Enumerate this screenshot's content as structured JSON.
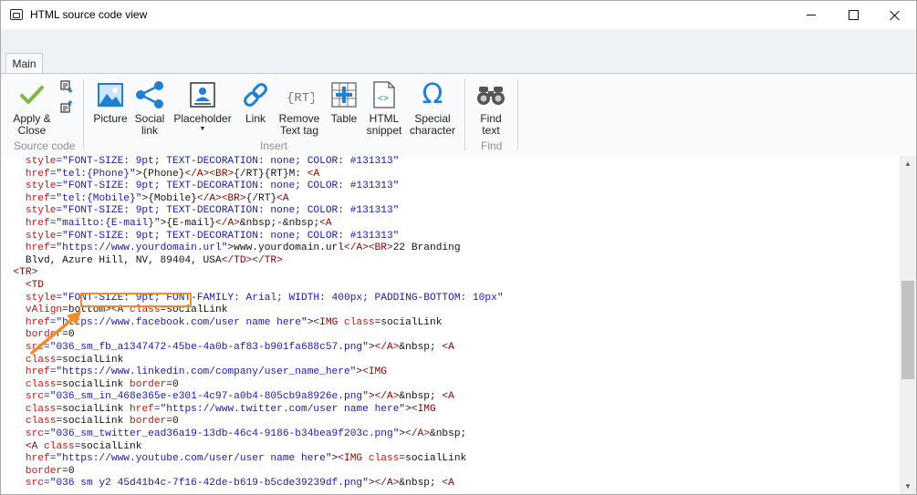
{
  "window": {
    "title": "HTML source code view"
  },
  "ribbon": {
    "tab_main": "Main",
    "groups": {
      "source_code": "Source code",
      "insert": "Insert",
      "find": "Find"
    },
    "buttons": {
      "apply_close_line1": "Apply &",
      "apply_close_line2": "Close",
      "picture": "Picture",
      "social_link_line1": "Social",
      "social_link_line2": "link",
      "placeholder": "Placeholder",
      "link": "Link",
      "remove_text_tag_line1": "Remove",
      "remove_text_tag_line2": "Text tag",
      "table": "Table",
      "html_snippet_line1": "HTML",
      "html_snippet_line2": "snippet",
      "special_char_line1": "Special",
      "special_char_line2": "character",
      "find_text_line1": "Find",
      "find_text_line2": "text"
    }
  },
  "colors": {
    "accent_orange": "#f28c28",
    "attr_red": "#c81414",
    "value_blue": "#1a1aa6",
    "check_green": "#7fba3a",
    "icon_blue": "#1f7fd0"
  },
  "code_lines": [
    [
      [
        "    ",
        "b"
      ],
      [
        "style",
        "r"
      ],
      [
        "=\"FONT-SIZE: 9pt; TEXT-DECORATION: none; COLOR: #131313\"",
        "u"
      ]
    ],
    [
      [
        "    ",
        "b"
      ],
      [
        "href",
        "r"
      ],
      [
        "=\"tel:",
        "u"
      ],
      [
        "{Phone}",
        "u"
      ],
      [
        "\"",
        "u"
      ],
      [
        ">{Phone}",
        "k"
      ],
      [
        "</A>",
        "t"
      ],
      [
        "<BR>",
        "t"
      ],
      [
        "{/RT}{RT}M: ",
        "k"
      ],
      [
        "<A",
        "t"
      ]
    ],
    [
      [
        "    ",
        "b"
      ],
      [
        "style",
        "r"
      ],
      [
        "=\"FONT-SIZE: 9pt; TEXT-DECORATION: none; COLOR: #131313\"",
        "u"
      ]
    ],
    [
      [
        "    ",
        "b"
      ],
      [
        "href",
        "r"
      ],
      [
        "=\"tel:",
        "u"
      ],
      [
        "{Mobile}",
        "u"
      ],
      [
        "\"",
        "u"
      ],
      [
        ">{Mobile}",
        "k"
      ],
      [
        "</A>",
        "t"
      ],
      [
        "<BR>",
        "t"
      ],
      [
        "{/RT}",
        "k"
      ],
      [
        "<A",
        "t"
      ]
    ],
    [
      [
        "    ",
        "b"
      ],
      [
        "style",
        "r"
      ],
      [
        "=\"FONT-SIZE: 9pt; TEXT-DECORATION: none; COLOR: #131313\"",
        "u"
      ]
    ],
    [
      [
        "    ",
        "b"
      ],
      [
        "href",
        "r"
      ],
      [
        "=\"mailto:",
        "u"
      ],
      [
        "{E-mail}",
        "u"
      ],
      [
        "\"",
        "u"
      ],
      [
        ">{E-mail}",
        "k"
      ],
      [
        "</A>",
        "t"
      ],
      [
        "&nbsp;-&nbsp;",
        "k"
      ],
      [
        "<A",
        "t"
      ]
    ],
    [
      [
        "    ",
        "b"
      ],
      [
        "style",
        "r"
      ],
      [
        "=\"FONT-SIZE: 9pt; TEXT-DECORATION: none; COLOR: #131313\"",
        "u"
      ]
    ],
    [
      [
        "    ",
        "b"
      ],
      [
        "href",
        "r"
      ],
      [
        "=\"https://www.yourdomain.url\"",
        "u"
      ],
      [
        ">www.yourdomain.url",
        "k"
      ],
      [
        "</A>",
        "t"
      ],
      [
        "<BR>",
        "t"
      ],
      [
        "22 Branding",
        "k"
      ]
    ],
    [
      [
        "    Blvd, Azure Hill, NV, 89404, USA",
        "k"
      ],
      [
        "</TD>",
        "t"
      ],
      [
        "</TR>",
        "t"
      ]
    ],
    [
      [
        "  ",
        "b"
      ],
      [
        "<TR>",
        "t"
      ]
    ],
    [
      [
        "    ",
        "b"
      ],
      [
        "<TD",
        "t"
      ]
    ],
    [
      [
        "    ",
        "b"
      ],
      [
        "style",
        "r"
      ],
      [
        "=\"FONT-SIZE: 9pt; FONT-FAMILY: Arial; WIDTH: 400px; PADDING-BOTTOM: 10px\"",
        "u"
      ]
    ],
    [
      [
        "    ",
        "b"
      ],
      [
        "vAlign",
        "r"
      ],
      [
        "=bottom>",
        "k"
      ],
      [
        "<A",
        "t"
      ],
      [
        " ",
        "k"
      ],
      [
        "class",
        "r"
      ],
      [
        "=socialLink",
        "k"
      ]
    ],
    [
      [
        "    ",
        "b"
      ],
      [
        "href",
        "r"
      ],
      [
        "=\"https://www.facebook.com/user name here\"",
        "u"
      ],
      [
        ">",
        "k"
      ],
      [
        "<IMG",
        "t"
      ],
      [
        " ",
        "k"
      ],
      [
        "class",
        "r"
      ],
      [
        "=socialLink",
        "k"
      ]
    ],
    [
      [
        "    ",
        "b"
      ],
      [
        "border",
        "r"
      ],
      [
        "=0",
        "k"
      ]
    ],
    [
      [
        "    ",
        "b"
      ],
      [
        "src",
        "r"
      ],
      [
        "=\"036_sm_fb_a1347472-45be-4a0b-af83-b901fa688c57.png\"",
        "u"
      ],
      [
        ">",
        "k"
      ],
      [
        "</A>",
        "t"
      ],
      [
        "&nbsp; ",
        "k"
      ],
      [
        "<A",
        "t"
      ]
    ],
    [
      [
        "    ",
        "b"
      ],
      [
        "class",
        "r"
      ],
      [
        "=socialLink",
        "k"
      ]
    ],
    [
      [
        "    ",
        "b"
      ],
      [
        "href",
        "r"
      ],
      [
        "=\"https://www.linkedin.com/company/user_name_here\"",
        "u"
      ],
      [
        ">",
        "k"
      ],
      [
        "<IMG",
        "t"
      ]
    ],
    [
      [
        "    ",
        "b"
      ],
      [
        "class",
        "r"
      ],
      [
        "=socialLink ",
        "k"
      ],
      [
        "border",
        "r"
      ],
      [
        "=0",
        "k"
      ]
    ],
    [
      [
        "    ",
        "b"
      ],
      [
        "src",
        "r"
      ],
      [
        "=\"036_sm_in_468e365e-e301-4c97-a0b4-805cb9a8926e.png\"",
        "u"
      ],
      [
        ">",
        "k"
      ],
      [
        "</A>",
        "t"
      ],
      [
        "&nbsp; ",
        "k"
      ],
      [
        "<A",
        "t"
      ]
    ],
    [
      [
        "    ",
        "b"
      ],
      [
        "class",
        "r"
      ],
      [
        "=socialLink ",
        "k"
      ],
      [
        "href",
        "r"
      ],
      [
        "=\"https://www.twitter.com/user name here\"",
        "u"
      ],
      [
        ">",
        "k"
      ],
      [
        "<IMG",
        "t"
      ]
    ],
    [
      [
        "    ",
        "b"
      ],
      [
        "class",
        "r"
      ],
      [
        "=socialLink ",
        "k"
      ],
      [
        "border",
        "r"
      ],
      [
        "=0",
        "k"
      ]
    ],
    [
      [
        "    ",
        "b"
      ],
      [
        "src",
        "r"
      ],
      [
        "=\"036_sm_twitter_ead36a19-13db-46c4-9186-b34bea9f203c.png\"",
        "u"
      ],
      [
        ">",
        "k"
      ],
      [
        "</A>",
        "t"
      ],
      [
        "&nbsp;",
        "k"
      ]
    ],
    [
      [
        "    ",
        "b"
      ],
      [
        "<A",
        "t"
      ],
      [
        " ",
        "k"
      ],
      [
        "class",
        "r"
      ],
      [
        "=socialLink",
        "k"
      ]
    ],
    [
      [
        "    ",
        "b"
      ],
      [
        "href",
        "r"
      ],
      [
        "=\"https://www.youtube.com/user/user name here\"",
        "u"
      ],
      [
        ">",
        "k"
      ],
      [
        "<IMG",
        "t"
      ],
      [
        " ",
        "k"
      ],
      [
        "class",
        "r"
      ],
      [
        "=socialLink",
        "k"
      ]
    ],
    [
      [
        "    ",
        "b"
      ],
      [
        "border",
        "r"
      ],
      [
        "=0",
        "k"
      ]
    ],
    [
      [
        "    ",
        "b"
      ],
      [
        "src",
        "r"
      ],
      [
        "=\"036 sm y2 45d41b4c-7f16-42de-b619-b5cde39239df.png\"",
        "u"
      ],
      [
        ">",
        "k"
      ],
      [
        "</A>",
        "t"
      ],
      [
        "&nbsp; ",
        "k"
      ],
      [
        "<A",
        "t"
      ]
    ]
  ]
}
